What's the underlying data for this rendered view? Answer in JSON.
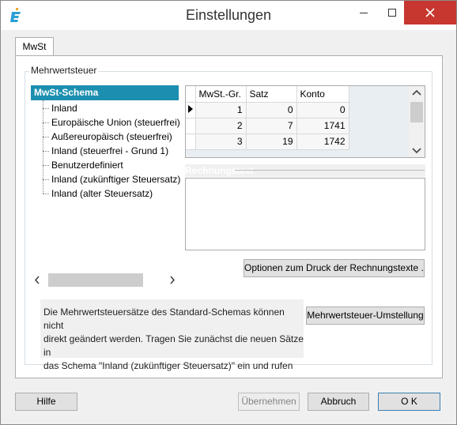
{
  "window": {
    "title": "Einstellungen"
  },
  "tabs": [
    {
      "label": "MwSt"
    }
  ],
  "group": {
    "caption": "Mehrwertsteuer"
  },
  "tree": {
    "root": "MwSt-Schema",
    "items": [
      "Inland",
      "Europäische Union (steuerfrei)",
      "Außereuropäisch (steuerfrei)",
      "Inland (steuerfrei - Grund 1)",
      "Benutzerdefiniert",
      "Inland (zukünftiger Steuersatz)",
      "Inland (alter Steuersatz)"
    ]
  },
  "grid": {
    "columns": [
      "MwSt.-Gr.",
      "Satz",
      "Konto"
    ],
    "rows": [
      [
        "1",
        "0",
        "0"
      ],
      [
        "2",
        "7",
        "1741"
      ],
      [
        "3",
        "19",
        "1742"
      ]
    ]
  },
  "rechnungstext": {
    "label": "Rechnungstext"
  },
  "buttons": {
    "options_print": "Optionen zum Druck der Rechnungstexte ...",
    "vat_change": "Mehrwertsteuer-Umstellung",
    "help": "Hilfe",
    "apply": "Übernehmen",
    "cancel": "Abbruch",
    "ok": "O K"
  },
  "info": {
    "line1": "Die Mehrwertsteuersätze des Standard-Schemas können nicht",
    "line2": "direkt geändert werden. Tragen Sie zunächst die neuen Sätze",
    "line3": "in",
    "line4": "das Schema \"Inland (zukünftiger Steuersatz)\" ein und rufen"
  },
  "colors": {
    "accent": "#1c8fb0",
    "close": "#c7372f"
  }
}
